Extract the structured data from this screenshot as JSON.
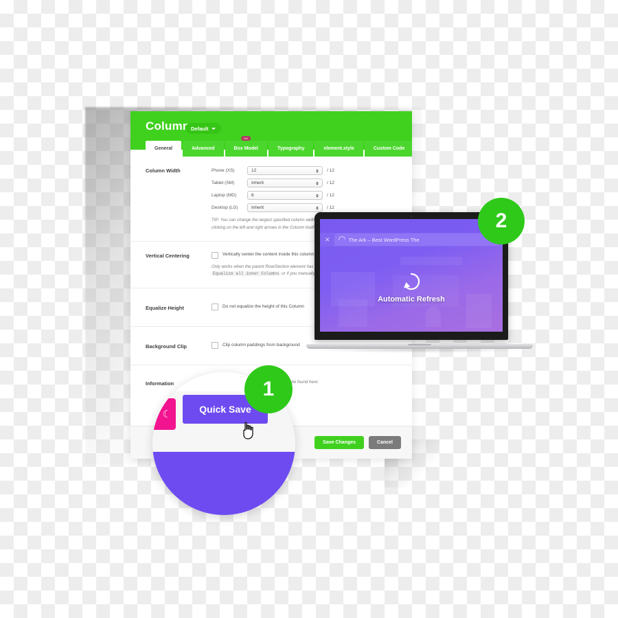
{
  "panel": {
    "title": "Column",
    "preset": {
      "label": "Default",
      "icon": "chevron-down-icon"
    },
    "tabs": [
      {
        "label": "General",
        "active": true,
        "badge": null
      },
      {
        "label": "Advanced",
        "active": false,
        "badge": null
      },
      {
        "label": "Box Model",
        "active": false,
        "badge": "NS"
      },
      {
        "label": "Typography",
        "active": false,
        "badge": null
      },
      {
        "label": "element.style",
        "active": false,
        "badge": null
      },
      {
        "label": "Custom Code",
        "active": false,
        "badge": null
      }
    ],
    "rows": {
      "column_width": {
        "label": "Column Width",
        "fields": [
          {
            "name": "Phone (XS)",
            "value": "12",
            "suffix": "/ 12"
          },
          {
            "name": "Tablet (SM)",
            "value": "Inherit",
            "suffix": "/ 12"
          },
          {
            "name": "Laptop (MD)",
            "value": "6",
            "suffix": "/ 12"
          },
          {
            "name": "Desktop (LG)",
            "value": "Inherit",
            "suffix": "/ 12"
          }
        ],
        "tip_line1": "TIP: You can change the largest specified column width by",
        "tip_line2": "clicking on the left and right arrows in the Column itself."
      },
      "vertical_centering": {
        "label": "Vertical Centering",
        "checkbox_label": "Vertically center the content inside this column",
        "note_line1": "Only works when the parent Row/Section element has",
        "note_code": "Equalize all inner Columns",
        "note_line2": "or if you manually set a fixed height."
      },
      "equalize_height": {
        "label": "Equalize Height",
        "checkbox_label": "Do not equalize the height of this Column"
      },
      "background_clip": {
        "label": "Background Clip",
        "checkbox_label": "Clip column paddings from background"
      },
      "information": {
        "label": "Information",
        "text": "More details about the Bootstrap Grid can be found here:"
      }
    },
    "footer": {
      "save_label": "Save Changes",
      "cancel_label": "Cancel"
    }
  },
  "laptop": {
    "browser": {
      "left_close_icon": "close-icon",
      "spinner_icon": "loading-spinner-icon",
      "tab_title": "The Ark – Best WordPress The",
      "tab_close_icon": "close-icon"
    },
    "overlay": {
      "icon": "refresh-circular-arrow-icon",
      "label": "Automatic Refresh"
    }
  },
  "magnifier": {
    "pink_icon": "moon-glyph-icon",
    "quick_save_label": "Quick Save",
    "cursor_icon": "pointing-hand-cursor-icon"
  },
  "callouts": [
    {
      "number": "1"
    },
    {
      "number": "2"
    }
  ],
  "colors": {
    "green": "#3fd11e",
    "bright_green": "#2fc91a",
    "purple": "#6d4bf0",
    "pink": "#f2138f",
    "gray": "#7b7b7b",
    "badge": "#b03a63"
  }
}
